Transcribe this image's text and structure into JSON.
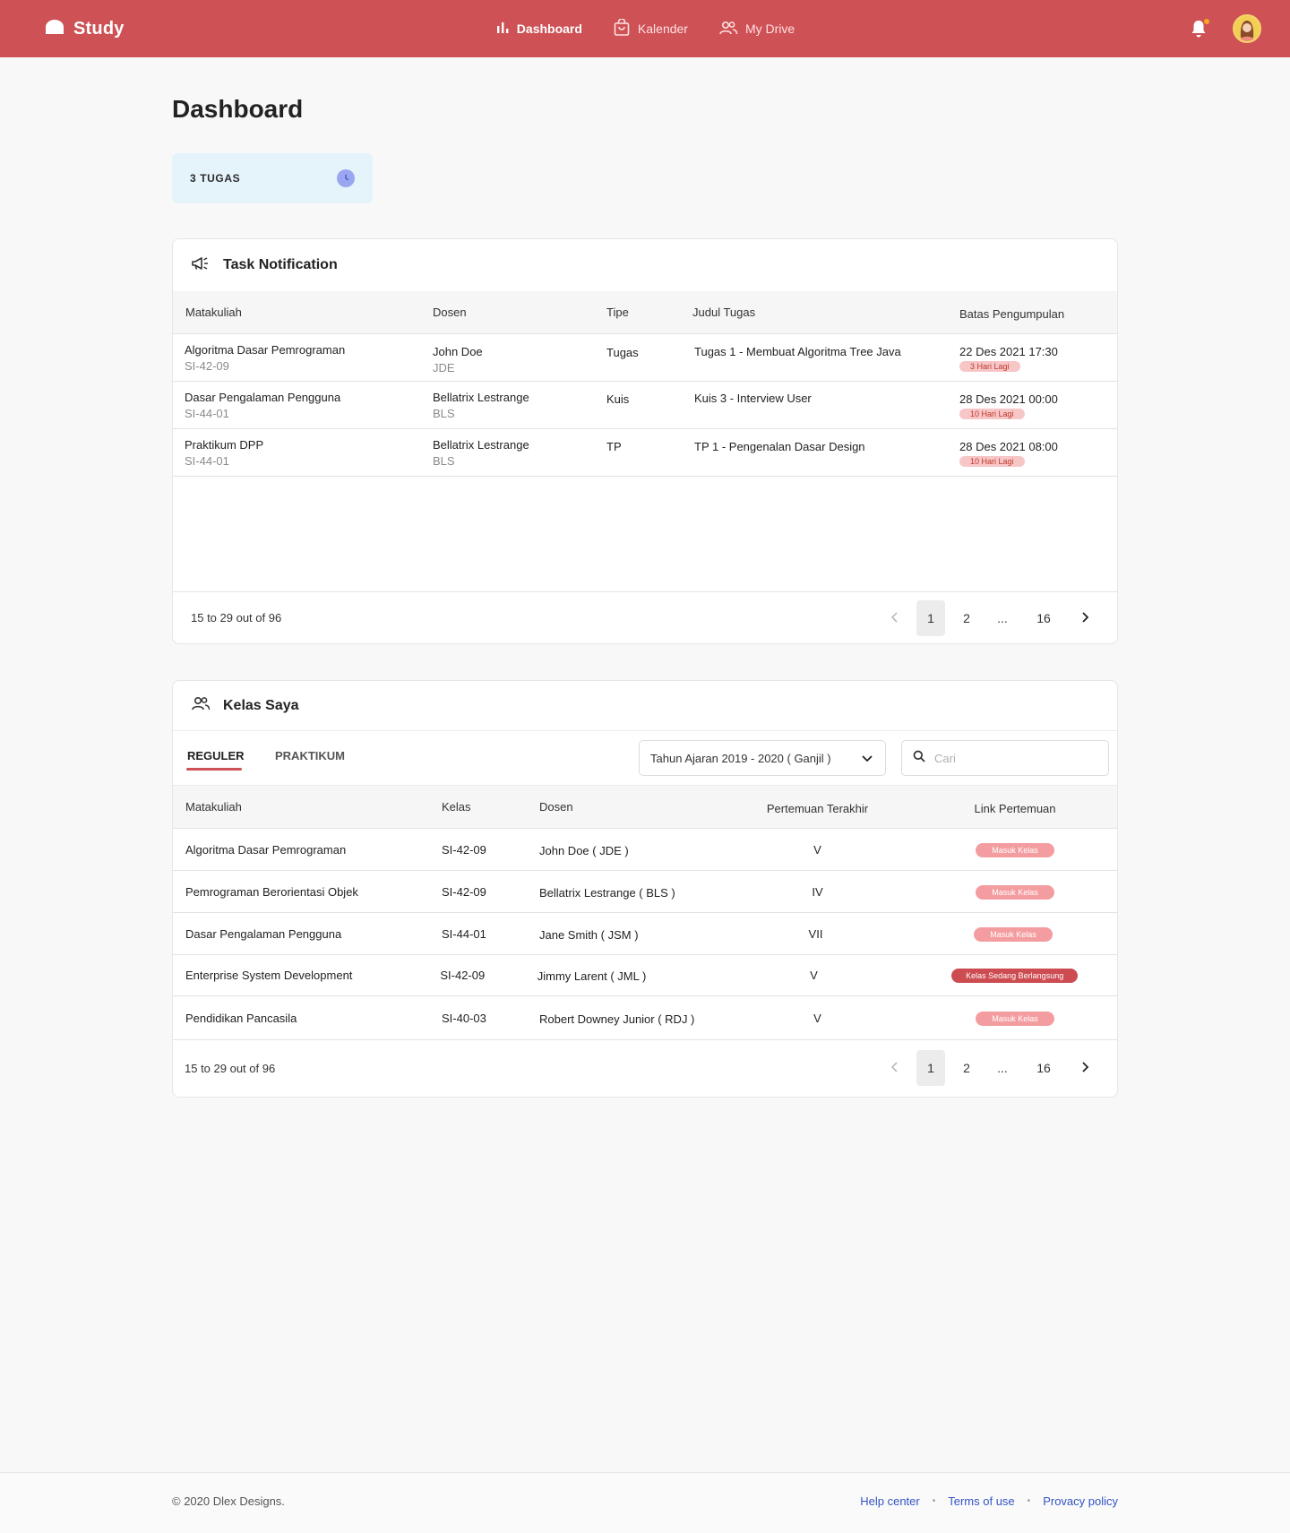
{
  "brand": {
    "name": "Study"
  },
  "nav": [
    {
      "label": "Dashboard",
      "active": true
    },
    {
      "label": "Kalender",
      "active": false
    },
    {
      "label": "My Drive",
      "active": false
    }
  ],
  "colors": {
    "primary": "#cd5155",
    "badge": "#f49da0",
    "live": "#cd4c51",
    "summary_bg": "#e5f4fb"
  },
  "page": {
    "title": "Dashboard"
  },
  "summary": {
    "label": "3 TUGAS",
    "icon": "clock-icon"
  },
  "tasks": {
    "title": "Task Notification",
    "icon": "megaphone-icon",
    "columns": [
      "Matakuliah",
      "Dosen",
      "Tipe",
      "Judul Tugas",
      "Batas Pengumpulan"
    ],
    "rows": [
      {
        "course": "Algoritma Dasar Pemrograman",
        "code": "SI-42-09",
        "lecturer": "John Doe",
        "lecturer_code": "JDE",
        "type": "Tugas",
        "title": "Tugas  1 - Membuat Algoritma Tree Java",
        "deadline": "22 Des 2021 17:30",
        "remaining": "3 Hari Lagi"
      },
      {
        "course": "Dasar Pengalaman Pengguna",
        "code": "SI-44-01",
        "lecturer": "Bellatrix Lestrange",
        "lecturer_code": "BLS",
        "type": "Kuis",
        "title": "Kuis  3 - Interview User",
        "deadline": "28 Des 2021 00:00",
        "remaining": "10 Hari Lagi"
      },
      {
        "course": "Praktikum DPP",
        "code": "SI-44-01",
        "lecturer": "Bellatrix Lestrange",
        "lecturer_code": "BLS",
        "type": "TP",
        "title": "TP 1 - Pengenalan Dasar Design",
        "deadline": "28 Des 2021 08:00",
        "remaining": "10 Hari Lagi"
      }
    ],
    "pagination": {
      "summary": "15 to 29 out of 96",
      "pages": [
        "1",
        "2",
        "...",
        "16"
      ],
      "current": "1"
    }
  },
  "classes": {
    "title": "Kelas Saya",
    "icon": "people-icon",
    "tabs": [
      "REGULER",
      "PRAKTIKUM"
    ],
    "active_tab": "REGULER",
    "term": "Tahun Ajaran 2019 - 2020 ( Ganjil )",
    "search_placeholder": "Cari",
    "columns": [
      "Matakuliah",
      "Kelas",
      "Dosen",
      "Pertemuan Terakhir",
      "Link Pertemuan"
    ],
    "rows": [
      {
        "course": "Algoritma Dasar Pemrograman",
        "class": "SI-42-09",
        "lecturer": "John Doe ( JDE )",
        "last_meeting": "V",
        "link": "Masuk Kelas",
        "live": false
      },
      {
        "course": "Pemrograman Berorientasi Objek",
        "class": "SI-42-09",
        "lecturer": "Bellatrix Lestrange ( BLS )",
        "last_meeting": "IV",
        "link": "Masuk Kelas",
        "live": false
      },
      {
        "course": "Dasar Pengalaman Pengguna",
        "class": "SI-44-01",
        "lecturer": "Jane Smith ( JSM )",
        "last_meeting": "VII",
        "link": "Masuk Kelas",
        "live": false
      },
      {
        "course": "Enterprise System Development",
        "class": "SI-42-09",
        "lecturer": "Jimmy Larent ( JML )",
        "last_meeting": "V",
        "link": "Kelas Sedang Berlangsung",
        "live": true
      },
      {
        "course": "Pendidikan Pancasila",
        "class": "SI-40-03",
        "lecturer": "Robert Downey Junior ( RDJ )",
        "last_meeting": "V",
        "link": "Masuk Kelas",
        "live": false
      }
    ],
    "pagination": {
      "summary": "15 to 29 out of 96",
      "pages": [
        "1",
        "2",
        "...",
        "16"
      ],
      "current": "1"
    }
  },
  "footer": {
    "copyright": "© 2020 Dlex Designs.",
    "links": [
      "Help center",
      "Terms of use",
      "Provacy policy"
    ]
  }
}
